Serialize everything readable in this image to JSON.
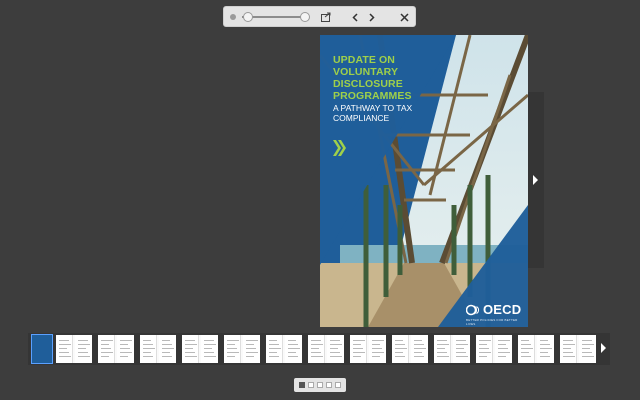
{
  "cover": {
    "title_lines": [
      "UPDATE ON",
      "VOLUNTARY",
      "DISCLOSURE",
      "PROGRAMMES"
    ],
    "subtitle_lines": [
      "A PATHWAY TO TAX",
      "COMPLIANCE"
    ],
    "publisher": "OECD",
    "tagline": "BETTER POLICIES FOR BETTER LIVES",
    "title_color": "#9fd04a",
    "brand_color": "#1f5e9a"
  },
  "toolbar": {
    "icons": [
      "zoom-out-icon",
      "zoom-in-icon",
      "share-icon",
      "previous-icon",
      "next-icon",
      "close-icon"
    ]
  },
  "thumbnails_count": 14,
  "pager": {
    "pages": 5,
    "active": 1
  }
}
